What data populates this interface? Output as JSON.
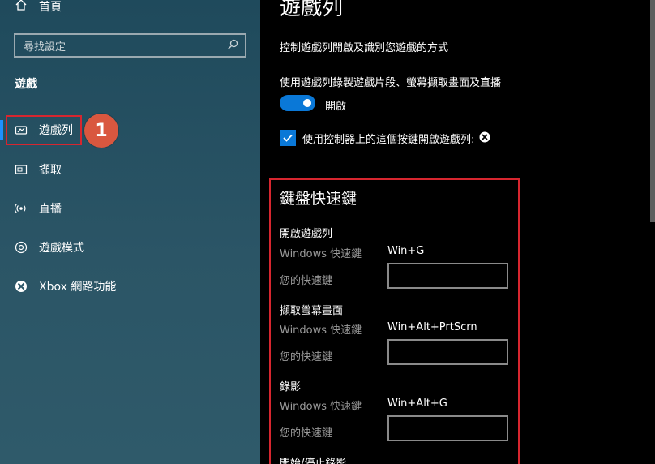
{
  "sidebar": {
    "home_label": "首頁",
    "search_placeholder": "尋找設定",
    "section_title": "遊戲",
    "items": [
      {
        "label": "遊戲列",
        "icon": "game-bar-icon"
      },
      {
        "label": "擷取",
        "icon": "capture-icon"
      },
      {
        "label": "直播",
        "icon": "broadcast-icon"
      },
      {
        "label": "遊戲模式",
        "icon": "game-mode-icon"
      },
      {
        "label": "Xbox 網路功能",
        "icon": "xbox-icon"
      }
    ],
    "annotation_number": "1"
  },
  "main": {
    "title": "遊戲列",
    "description": "控制遊戲列開啟及識別您遊戲的方式",
    "record_label": "使用遊戲列錄製遊戲片段、螢幕擷取畫面及直播",
    "toggle_state": "開啟",
    "toggle_on": true,
    "controller_checkbox_label": "使用控制器上的這個按鍵開啟遊戲列:",
    "controller_checked": true,
    "shortcuts": {
      "title": "鍵盤快速鍵",
      "windows_label": "Windows 快速鍵",
      "yours_label": "您的快速鍵",
      "groups": [
        {
          "name": "開啟遊戲列",
          "windows_shortcut": "Win+G",
          "your_shortcut": ""
        },
        {
          "name": "擷取螢幕畫面",
          "windows_shortcut": "Win+Alt+PrtScrn",
          "your_shortcut": ""
        },
        {
          "name": "錄影",
          "windows_shortcut": "Win+Alt+G",
          "your_shortcut": ""
        },
        {
          "name": "開始/停止錄影"
        }
      ]
    }
  },
  "colors": {
    "accent": "#0a78d7",
    "highlight_red": "#d7262f",
    "badge_orange": "#d9573f"
  }
}
